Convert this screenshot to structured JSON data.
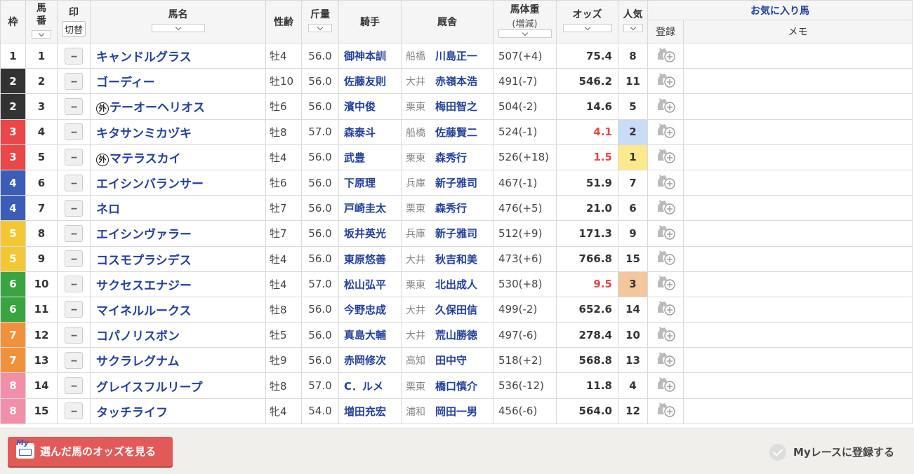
{
  "headers": {
    "waku": "枠",
    "umaban": "馬番",
    "mark": "印",
    "mark_toggle": "切替",
    "name": "馬名",
    "sex_age": "性齢",
    "kinryo": "斤量",
    "jockey": "騎手",
    "trainer": "厩舎",
    "weight": "馬体重",
    "weight_sub": "(増減)",
    "odds": "オッズ",
    "ninki": "人気",
    "favorites": "お気に入り馬",
    "register": "登録",
    "memo": "メモ"
  },
  "mark_placeholder": "--",
  "foreign_mark": "外",
  "horses": [
    {
      "waku": "1",
      "waku_class": "w1",
      "umaban": "1",
      "foreign": false,
      "name": "キャンドルグラス",
      "sex_age": "牡4",
      "kinryo": "56.0",
      "jockey": "御神本訓",
      "area": "船橋",
      "trainer": "川島正一",
      "weight": "507(+4)",
      "odds": "75.4",
      "hot": false,
      "ninki": "8",
      "pop_class": ""
    },
    {
      "waku": "2",
      "waku_class": "w2",
      "umaban": "2",
      "foreign": false,
      "name": "ゴーディー",
      "sex_age": "牡10",
      "kinryo": "56.0",
      "jockey": "佐藤友則",
      "area": "大井",
      "trainer": "赤嶺本浩",
      "weight": "491(-7)",
      "odds": "546.2",
      "hot": false,
      "ninki": "11",
      "pop_class": ""
    },
    {
      "waku": "2",
      "waku_class": "w2",
      "umaban": "3",
      "foreign": true,
      "name": "テーオーヘリオス",
      "sex_age": "牡6",
      "kinryo": "56.0",
      "jockey": "濱中俊",
      "area": "栗東",
      "trainer": "梅田智之",
      "weight": "504(-2)",
      "odds": "14.6",
      "hot": false,
      "ninki": "5",
      "pop_class": ""
    },
    {
      "waku": "3",
      "waku_class": "w3",
      "umaban": "4",
      "foreign": false,
      "name": "キタサンミカヅキ",
      "sex_age": "牡8",
      "kinryo": "57.0",
      "jockey": "森泰斗",
      "area": "船橋",
      "trainer": "佐藤賢二",
      "weight": "524(-1)",
      "odds": "4.1",
      "hot": true,
      "ninki": "2",
      "pop_class": "p2"
    },
    {
      "waku": "3",
      "waku_class": "w3",
      "umaban": "5",
      "foreign": true,
      "name": "マテラスカイ",
      "sex_age": "牡4",
      "kinryo": "56.0",
      "jockey": "武豊",
      "area": "栗東",
      "trainer": "森秀行",
      "weight": "526(+18)",
      "odds": "1.5",
      "hot": true,
      "ninki": "1",
      "pop_class": "p1"
    },
    {
      "waku": "4",
      "waku_class": "w4",
      "umaban": "6",
      "foreign": false,
      "name": "エイシンバランサー",
      "sex_age": "牡6",
      "kinryo": "56.0",
      "jockey": "下原理",
      "area": "兵庫",
      "trainer": "新子雅司",
      "weight": "467(-1)",
      "odds": "51.9",
      "hot": false,
      "ninki": "7",
      "pop_class": ""
    },
    {
      "waku": "4",
      "waku_class": "w4",
      "umaban": "7",
      "foreign": false,
      "name": "ネロ",
      "sex_age": "牡7",
      "kinryo": "56.0",
      "jockey": "戸崎圭太",
      "area": "栗東",
      "trainer": "森秀行",
      "weight": "476(+5)",
      "odds": "21.0",
      "hot": false,
      "ninki": "6",
      "pop_class": ""
    },
    {
      "waku": "5",
      "waku_class": "w5",
      "umaban": "8",
      "foreign": false,
      "name": "エイシンヴァラー",
      "sex_age": "牡7",
      "kinryo": "56.0",
      "jockey": "坂井英光",
      "area": "兵庫",
      "trainer": "新子雅司",
      "weight": "512(+9)",
      "odds": "171.3",
      "hot": false,
      "ninki": "9",
      "pop_class": ""
    },
    {
      "waku": "5",
      "waku_class": "w5",
      "umaban": "9",
      "foreign": false,
      "name": "コスモプラシデス",
      "sex_age": "牡4",
      "kinryo": "56.0",
      "jockey": "東原悠善",
      "area": "大井",
      "trainer": "秋吉和美",
      "weight": "473(+6)",
      "odds": "766.8",
      "hot": false,
      "ninki": "15",
      "pop_class": ""
    },
    {
      "waku": "6",
      "waku_class": "w6",
      "umaban": "10",
      "foreign": false,
      "name": "サクセスエナジー",
      "sex_age": "牡4",
      "kinryo": "57.0",
      "jockey": "松山弘平",
      "area": "栗東",
      "trainer": "北出成人",
      "weight": "530(+8)",
      "odds": "9.5",
      "hot": true,
      "ninki": "3",
      "pop_class": "p3"
    },
    {
      "waku": "6",
      "waku_class": "w6",
      "umaban": "11",
      "foreign": false,
      "name": "マイネルルークス",
      "sex_age": "牡8",
      "kinryo": "56.0",
      "jockey": "今野忠成",
      "area": "大井",
      "trainer": "久保田信",
      "weight": "499(-2)",
      "odds": "652.6",
      "hot": false,
      "ninki": "14",
      "pop_class": ""
    },
    {
      "waku": "7",
      "waku_class": "w7",
      "umaban": "12",
      "foreign": false,
      "name": "コパノリスボン",
      "sex_age": "牡5",
      "kinryo": "56.0",
      "jockey": "真島大輔",
      "area": "大井",
      "trainer": "荒山勝徳",
      "weight": "497(-6)",
      "odds": "278.4",
      "hot": false,
      "ninki": "10",
      "pop_class": ""
    },
    {
      "waku": "7",
      "waku_class": "w7",
      "umaban": "13",
      "foreign": false,
      "name": "サクラレグナム",
      "sex_age": "牡9",
      "kinryo": "56.0",
      "jockey": "赤岡修次",
      "area": "高知",
      "trainer": "田中守",
      "weight": "518(+2)",
      "odds": "568.8",
      "hot": false,
      "ninki": "13",
      "pop_class": ""
    },
    {
      "waku": "8",
      "waku_class": "w8",
      "umaban": "14",
      "foreign": false,
      "name": "グレイスフルリープ",
      "sex_age": "牡8",
      "kinryo": "57.0",
      "jockey": "C．ルメ",
      "area": "栗東",
      "trainer": "橋口慎介",
      "weight": "536(-12)",
      "odds": "11.8",
      "hot": false,
      "ninki": "4",
      "pop_class": ""
    },
    {
      "waku": "8",
      "waku_class": "w8",
      "umaban": "15",
      "foreign": false,
      "name": "タッチライフ",
      "sex_age": "牝4",
      "kinryo": "54.0",
      "jockey": "増田充宏",
      "area": "浦和",
      "trainer": "岡田一男",
      "weight": "456(-6)",
      "odds": "564.0",
      "hot": false,
      "ninki": "12",
      "pop_class": ""
    }
  ],
  "footer": {
    "odds_button": "選んだ馬のオッズを見る",
    "my_badge": "My",
    "myrace_label": "Myレースに登録する"
  },
  "colors": {
    "link_blue": "#23419b",
    "hot_odds": "#e5474c",
    "button_red": "#e25a57"
  }
}
